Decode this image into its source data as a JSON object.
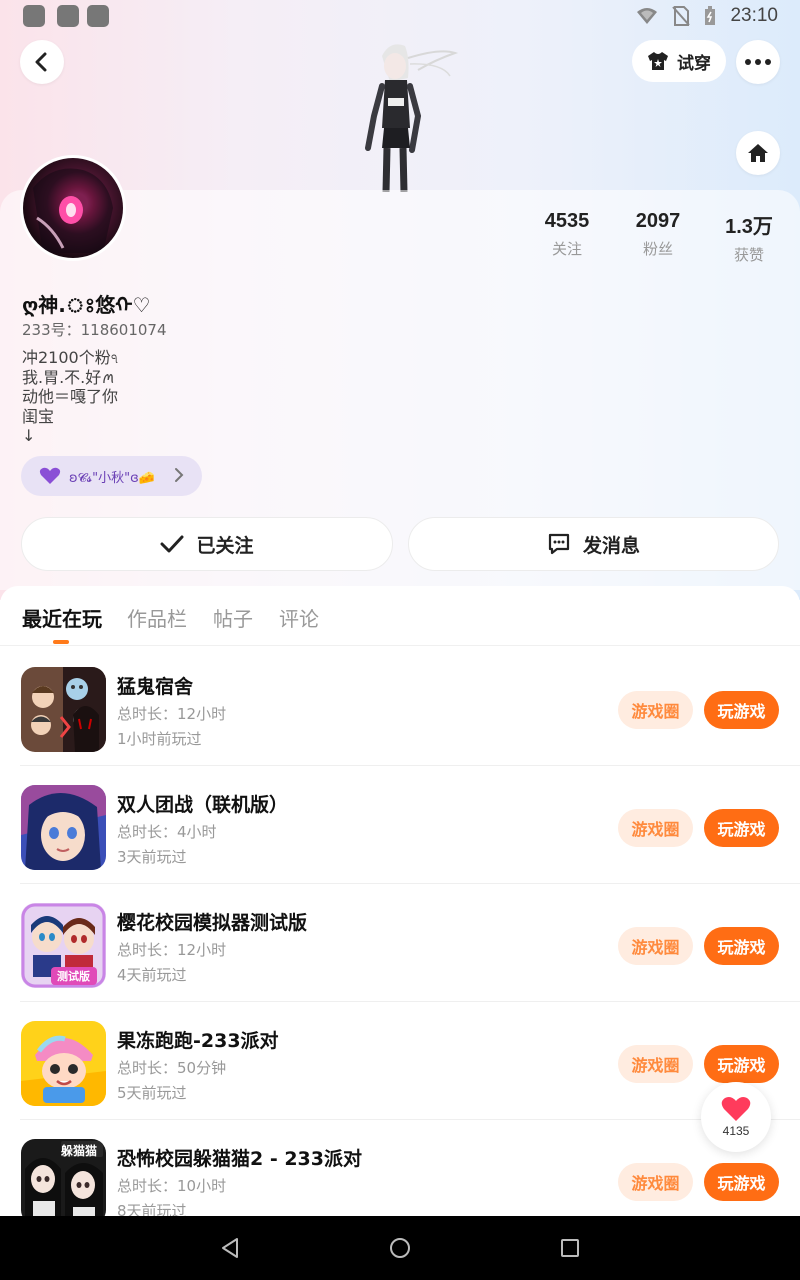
{
  "status_bar": {
    "time": "23:10"
  },
  "header": {
    "tryon_label": "试穿"
  },
  "profile": {
    "nickname": "ღ神.ঃ悠ᡣ♡",
    "user_id": "233号：118601074",
    "bio_lines": [
      "冲2100个粉ঀ",
      "我.胃.不.好ꪔ",
      "动他＝嘎了你",
      "闺宝",
      "↓"
    ],
    "relation_pill": "ʚ𝓒𝓼\"小秋\"ɞ🧀"
  },
  "stats": [
    {
      "value": "4535",
      "label": "关注"
    },
    {
      "value": "2097",
      "label": "粉丝"
    },
    {
      "value": "1.3万",
      "label": "获赞"
    }
  ],
  "actions": {
    "follow_label": "已关注",
    "message_label": "发消息"
  },
  "tabs": [
    {
      "label": "最近在玩",
      "active": true
    },
    {
      "label": "作品栏",
      "active": false
    },
    {
      "label": "帖子",
      "active": false
    },
    {
      "label": "评论",
      "active": false
    }
  ],
  "games": [
    {
      "title": "猛鬼宿舍",
      "duration": "总时长：12小时",
      "last_played": "1小时前玩过",
      "circle_label": "游戏圈",
      "play_label": "玩游戏"
    },
    {
      "title": "双人团战（联机版）",
      "duration": "总时长：4小时",
      "last_played": "3天前玩过",
      "circle_label": "游戏圈",
      "play_label": "玩游戏"
    },
    {
      "title": "樱花校园模拟器测试版",
      "duration": "总时长：12小时",
      "last_played": "4天前玩过",
      "circle_label": "游戏圈",
      "play_label": "玩游戏",
      "icon_text": "测试版"
    },
    {
      "title": "果冻跑跑-233派对",
      "duration": "总时长：50分钟",
      "last_played": "5天前玩过",
      "circle_label": "游戏圈",
      "play_label": "玩游戏"
    },
    {
      "title": "恐怖校园躲猫猫2 - 233派对",
      "duration": "总时长：10小时",
      "last_played": "8天前玩过",
      "circle_label": "游戏圈",
      "play_label": "玩游戏",
      "icon_text": "躲猫猫"
    }
  ],
  "like_float": {
    "count": "4135"
  },
  "colors": {
    "accent": "#ff6d14",
    "accent_soft": "#ffece0",
    "pill_bg": "#e8e2f5",
    "heart": "#ff3b5c"
  }
}
